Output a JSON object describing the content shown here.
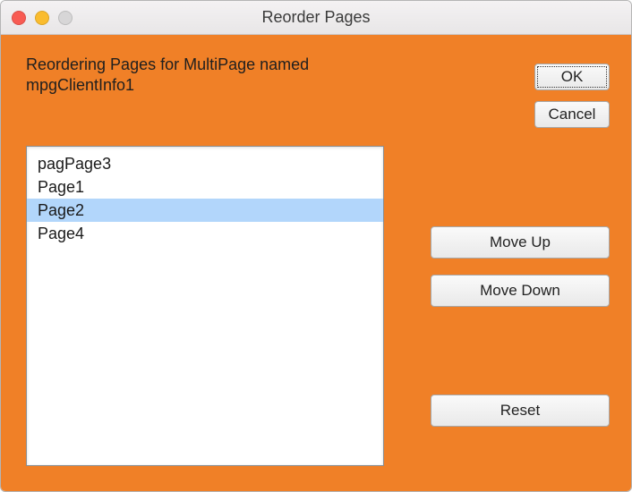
{
  "window": {
    "title": "Reorder Pages"
  },
  "heading": {
    "line1": "Reordering Pages for MultiPage named",
    "line2": "mpgClientInfo1"
  },
  "buttons": {
    "ok": "OK",
    "cancel": "Cancel",
    "moveUp": "Move Up",
    "moveDown": "Move Down",
    "reset": "Reset"
  },
  "list": {
    "items": [
      "pagPage3",
      "Page1",
      "Page2",
      "Page4"
    ],
    "selectedIndex": 2
  }
}
